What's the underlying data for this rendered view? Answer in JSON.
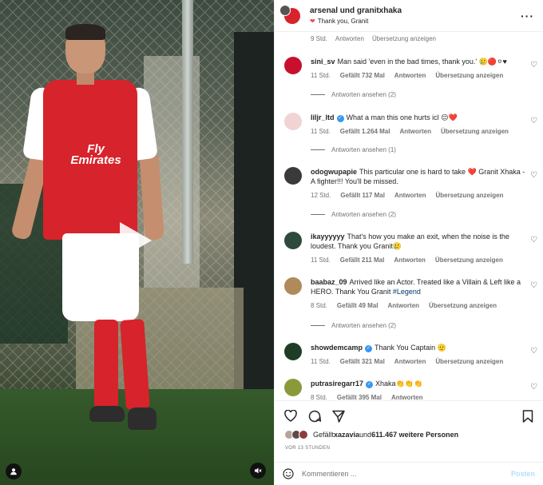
{
  "colors": {
    "accent": "#0095f6",
    "like_red": "#ed4956",
    "verified": "#3897f0",
    "arsenal_red": "#d7232b"
  },
  "video": {
    "sponsor_text": "Fly Emirates",
    "play_icon": "play-icon",
    "mute_icon": "speaker-muted-icon",
    "user_tag_icon": "user-icon"
  },
  "header": {
    "title": "arsenal und granitxhaka",
    "subtitle": "Thank you, Granit",
    "subtitle_icon": "heart-icon",
    "more_icon": "more-horizontal-icon",
    "more_label": "···"
  },
  "top_meta": {
    "time": "9 Std.",
    "reply": "Antworten",
    "translate": "Übersetzung anzeigen"
  },
  "comments": [
    {
      "user": "sini_sv",
      "verified": false,
      "text": "Man said 'even in the bad times, thank you.' 🥲🔴⚪♥",
      "time": "11 Std.",
      "likes": "Gefällt 732 Mal",
      "reply": "Antworten",
      "translate": "Übersetzung anzeigen",
      "answers": "Antworten ansehen (2)"
    },
    {
      "user": "liljr_ltd",
      "verified": true,
      "text": "What a man this one hurts icl 😔❤️",
      "time": "11 Std.",
      "likes": "Gefällt 1.264 Mal",
      "reply": "Antworten",
      "translate": "Übersetzung anzeigen",
      "answers": "Antworten ansehen (1)"
    },
    {
      "user": "odogwupapie",
      "verified": false,
      "text": "This particular one is hard to take ❤️ Granit Xhaka - A fighter!!! You'll be missed.",
      "time": "12 Std.",
      "likes": "Gefällt 117 Mal",
      "reply": "Antworten",
      "translate": "Übersetzung anzeigen",
      "answers": "Antworten ansehen (2)"
    },
    {
      "user": "ikayyyyyy",
      "verified": false,
      "text": "That's how you make an exit, when the noise is the loudest. Thank you Granit🥲",
      "time": "11 Std.",
      "likes": "Gefällt 211 Mal",
      "reply": "Antworten",
      "translate": "Übersetzung anzeigen",
      "answers": ""
    },
    {
      "user": "baabaz_09",
      "verified": false,
      "text": "Arrived like an Actor. Treated like a Villain & Left like a HERO. Thank You Granit ",
      "hashtag": "#Legend",
      "time": "8 Std.",
      "likes": "Gefällt 49 Mal",
      "reply": "Antworten",
      "translate": "Übersetzung anzeigen",
      "answers": "Antworten ansehen (2)"
    },
    {
      "user": "showdemcamp",
      "verified": true,
      "text": "Thank You Captain 🫡",
      "time": "11 Std.",
      "likes": "Gefällt 321 Mal",
      "reply": "Antworten",
      "translate": "Übersetzung anzeigen",
      "answers": ""
    },
    {
      "user": "putrasiregarr17",
      "verified": true,
      "text": "Xhaka👏👏👏",
      "time": "8 Std.",
      "likes": "Gefällt 395 Mal",
      "reply": "Antworten",
      "translate": "",
      "answers": ""
    }
  ],
  "actions": {
    "like_icon": "heart-outline-icon",
    "comment_icon": "comment-icon",
    "share_icon": "send-icon",
    "save_icon": "bookmark-icon"
  },
  "likes_summary": {
    "prefix": "Gefällt ",
    "user": "xazavia",
    "middle": " und ",
    "count": "611.467 weitere Personen"
  },
  "posted": "VOR 13 STUNDEN",
  "composer": {
    "emoji_icon": "smiley-icon",
    "placeholder": "Kommentieren ...",
    "post_label": "Posten"
  }
}
